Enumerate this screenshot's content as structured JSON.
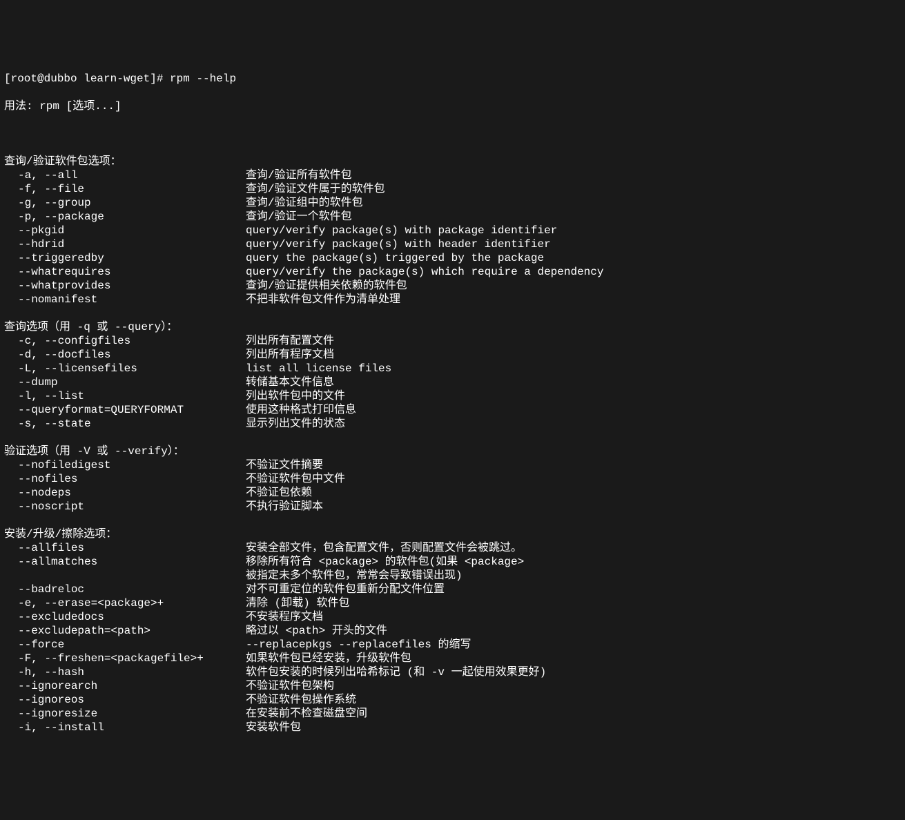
{
  "prompt": "[root@dubbo learn-wget]# rpm --help",
  "usage": "用法: rpm [选项...]",
  "sections": [
    {
      "header": "查询/验证软件包选项：",
      "options": [
        {
          "flag": "-a, --all",
          "desc": "查询/验证所有软件包"
        },
        {
          "flag": "-f, --file",
          "desc": "查询/验证文件属于的软件包"
        },
        {
          "flag": "-g, --group",
          "desc": "查询/验证组中的软件包"
        },
        {
          "flag": "-p, --package",
          "desc": "查询/验证一个软件包"
        },
        {
          "flag": "--pkgid",
          "desc": "query/verify package(s) with package identifier"
        },
        {
          "flag": "--hdrid",
          "desc": "query/verify package(s) with header identifier"
        },
        {
          "flag": "--triggeredby",
          "desc": "query the package(s) triggered by the package"
        },
        {
          "flag": "--whatrequires",
          "desc": "query/verify the package(s) which require a dependency"
        },
        {
          "flag": "--whatprovides",
          "desc": "查询/验证提供相关依赖的软件包"
        },
        {
          "flag": "--nomanifest",
          "desc": "不把非软件包文件作为清单处理"
        }
      ]
    },
    {
      "header": "查询选项（用 -q 或 --query）：",
      "options": [
        {
          "flag": "-c, --configfiles",
          "desc": "列出所有配置文件"
        },
        {
          "flag": "-d, --docfiles",
          "desc": "列出所有程序文档"
        },
        {
          "flag": "-L, --licensefiles",
          "desc": "list all license files"
        },
        {
          "flag": "--dump",
          "desc": "转储基本文件信息"
        },
        {
          "flag": "-l, --list",
          "desc": "列出软件包中的文件"
        },
        {
          "flag": "--queryformat=QUERYFORMAT",
          "desc": "使用这种格式打印信息"
        },
        {
          "flag": "-s, --state",
          "desc": "显示列出文件的状态"
        }
      ]
    },
    {
      "header": "验证选项（用 -V 或 --verify）：",
      "options": [
        {
          "flag": "--nofiledigest",
          "desc": "不验证文件摘要"
        },
        {
          "flag": "--nofiles",
          "desc": "不验证软件包中文件"
        },
        {
          "flag": "--nodeps",
          "desc": "不验证包依赖"
        },
        {
          "flag": "--noscript",
          "desc": "不执行验证脚本"
        }
      ]
    },
    {
      "header": "安装/升级/擦除选项：",
      "options": [
        {
          "flag": "--allfiles",
          "desc": "安装全部文件，包含配置文件，否则配置文件会被跳过。"
        },
        {
          "flag": "--allmatches",
          "desc": "移除所有符合 <package> 的软件包(如果 <package>",
          "cont": "被指定未多个软件包，常常会导致错误出现)"
        },
        {
          "flag": "--badreloc",
          "desc": "对不可重定位的软件包重新分配文件位置"
        },
        {
          "flag": "-e, --erase=<package>+",
          "desc": "清除 (卸载) 软件包"
        },
        {
          "flag": "--excludedocs",
          "desc": "不安装程序文档"
        },
        {
          "flag": "--excludepath=<path>",
          "desc": "略过以 <path> 开头的文件"
        },
        {
          "flag": "--force",
          "desc": "--replacepkgs --replacefiles 的缩写"
        },
        {
          "flag": "-F, --freshen=<packagefile>+",
          "desc": "如果软件包已经安装，升级软件包"
        },
        {
          "flag": "-h, --hash",
          "desc": "软件包安装的时候列出哈希标记 (和 -v 一起使用效果更好)"
        },
        {
          "flag": "--ignorearch",
          "desc": "不验证软件包架构"
        },
        {
          "flag": "--ignoreos",
          "desc": "不验证软件包操作系统"
        },
        {
          "flag": "--ignoresize",
          "desc": "在安装前不检查磁盘空间"
        },
        {
          "flag": "-i, --install",
          "desc": "安装软件包"
        }
      ]
    }
  ]
}
